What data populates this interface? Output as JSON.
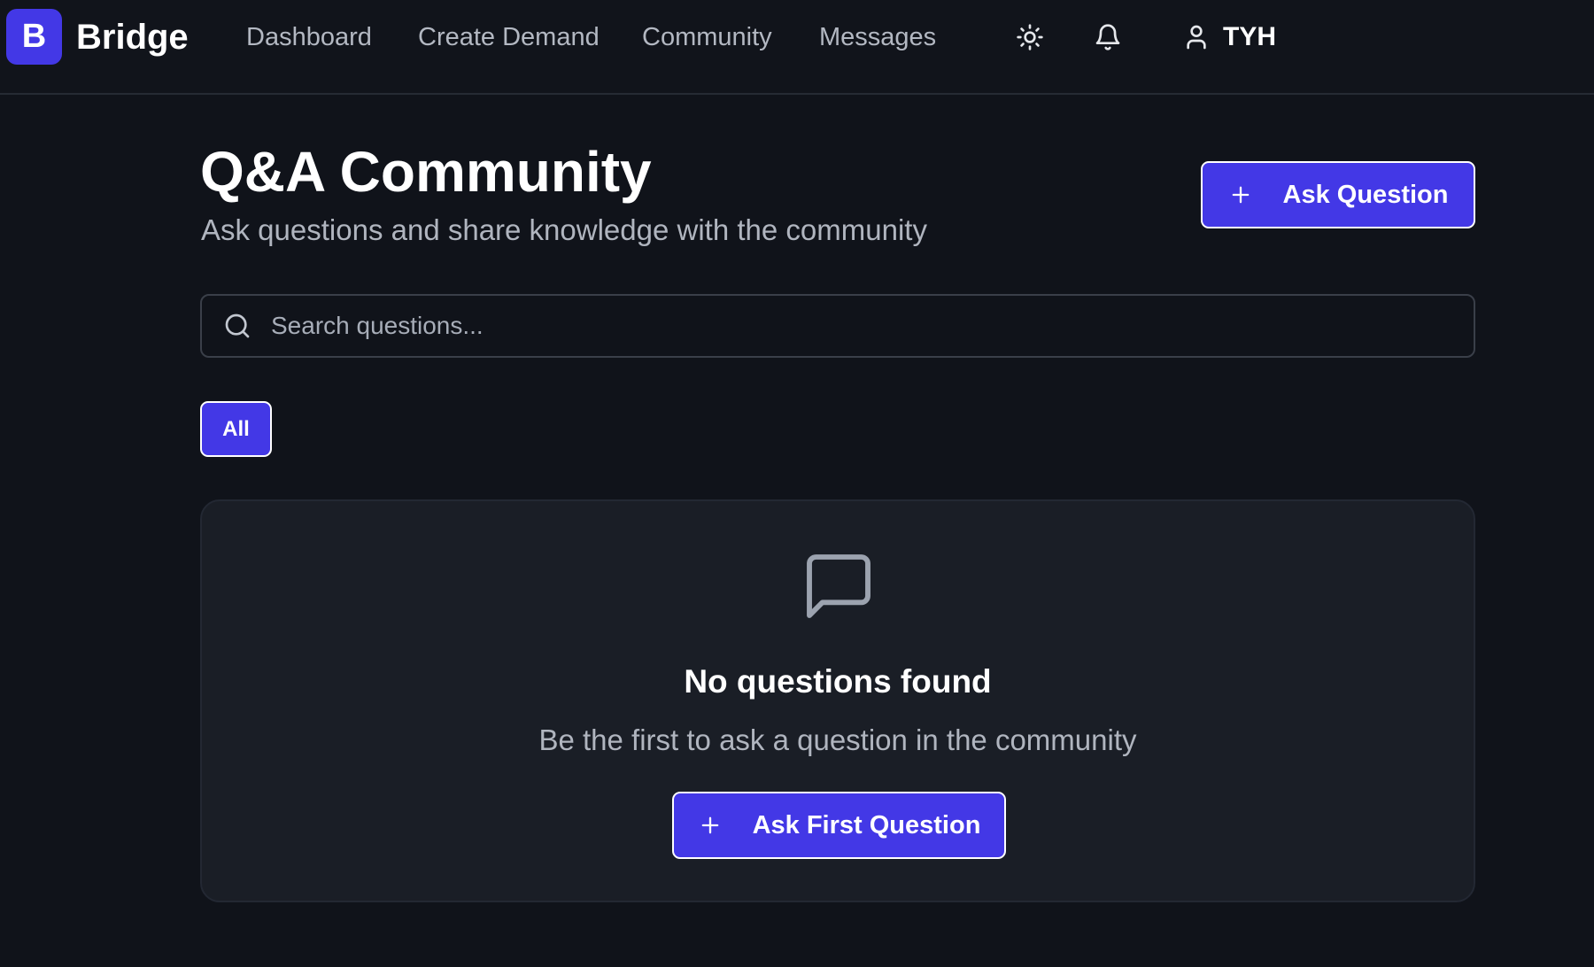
{
  "header": {
    "logo_letter": "B",
    "brand": "Bridge",
    "nav": [
      {
        "label": "Dashboard"
      },
      {
        "label": "Create Demand"
      },
      {
        "label": "Community"
      },
      {
        "label": "Messages"
      }
    ],
    "icons": [
      "sun-icon",
      "bell-icon",
      "user-icon"
    ],
    "user_name": "TYH"
  },
  "main": {
    "title": "Q&A Community",
    "subtitle": "Ask questions and share knowledge with the community",
    "ask_button": "Ask Question",
    "search": {
      "placeholder": "Search questions...",
      "value": ""
    },
    "filters": [
      {
        "label": "All",
        "active": true
      }
    ],
    "empty_state": {
      "icon": "message-square-icon",
      "title": "No questions found",
      "message": "Be the first to ask a question in the community",
      "button": "Ask First Question"
    }
  },
  "colors": {
    "accent": "#4338e6",
    "background": "#10131a",
    "card": "#1a1e26",
    "muted_text": "#b0b5bf"
  }
}
